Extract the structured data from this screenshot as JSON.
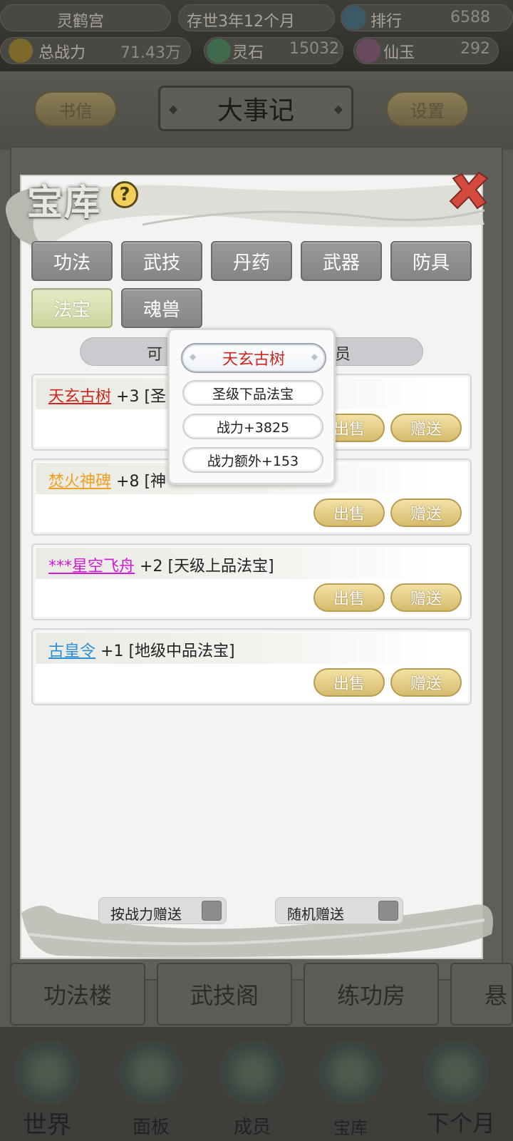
{
  "status": {
    "sect_name": "灵鹤宫",
    "time_label": "存世3年12个月",
    "rank_label": "排行",
    "rank_value": "6588",
    "power_label": "总战力",
    "power_value": "71.43万",
    "spirit_stone_label": "灵石",
    "spirit_stone_value": "15032",
    "jade_label": "仙玉",
    "jade_value": "292"
  },
  "header": {
    "letters_button": "书信",
    "title": "大事记",
    "settings_button": "设置"
  },
  "facility_tabs": [
    "功法楼",
    "武技阁",
    "练功房",
    "悬"
  ],
  "bottom_nav": [
    "世界",
    "面板",
    "成员",
    "宝库",
    "下个月"
  ],
  "modal": {
    "title": "宝库",
    "help_icon": "question-icon",
    "close_icon": "close-x-icon",
    "categories": [
      "功法",
      "武技",
      "丹药",
      "武器",
      "防具",
      "法宝",
      "魂兽"
    ],
    "active_category": "法宝",
    "filter_left": "可",
    "filter_right": "员",
    "items": [
      {
        "name": "天玄古树",
        "suffix": "+3 [圣",
        "color": "#d0261d",
        "sell": "出售",
        "gift": "赠送"
      },
      {
        "name": "焚火神碑",
        "suffix": "+8 [神",
        "color": "#f0a020",
        "sell": "出售",
        "gift": "赠送"
      },
      {
        "name": "***星空飞舟",
        "suffix": "+2 [天级上品法宝]",
        "color": "#d21ad8",
        "sell": "出售",
        "gift": "赠送"
      },
      {
        "name": "古皇令",
        "suffix": "+1 [地级中品法宝]",
        "color": "#2a8fd6",
        "sell": "出售",
        "gift": "赠送"
      }
    ],
    "toggles": [
      {
        "label": "按战力赠送"
      },
      {
        "label": "随机赠送"
      }
    ]
  },
  "popup": {
    "title": "天玄古树",
    "grade": "圣级下品法宝",
    "power": "战力+3825",
    "extra_power": "战力额外+153"
  }
}
